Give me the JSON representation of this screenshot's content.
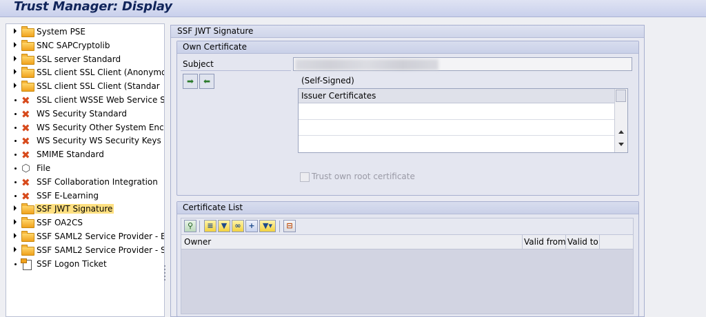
{
  "window": {
    "title": "Trust Manager: Display"
  },
  "tree": {
    "items": [
      {
        "label": "System PSE",
        "icon": "folder-icon",
        "expandable": true
      },
      {
        "label": "SNC SAPCryptolib",
        "icon": "folder-icon",
        "expandable": true
      },
      {
        "label": "SSL server Standard",
        "icon": "folder-icon",
        "expandable": true
      },
      {
        "label": "SSL client SSL Client (Anonymo",
        "icon": "folder-icon",
        "expandable": true
      },
      {
        "label": "SSL client SSL Client (Standar",
        "icon": "folder-icon",
        "expandable": true
      },
      {
        "label": "SSL client WSSE Web Service Se",
        "icon": "error-x-icon",
        "expandable": false
      },
      {
        "label": "WS Security Standard",
        "icon": "error-x-icon",
        "expandable": false
      },
      {
        "label": "WS Security Other System Encr",
        "icon": "error-x-icon",
        "expandable": false
      },
      {
        "label": "WS Security WS Security Keys",
        "icon": "error-x-icon",
        "expandable": false
      },
      {
        "label": "SMIME Standard",
        "icon": "error-x-icon",
        "expandable": false
      },
      {
        "label": "File",
        "icon": "file-icon",
        "expandable": false
      },
      {
        "label": "SSF Collaboration Integration",
        "icon": "error-x-icon",
        "expandable": false
      },
      {
        "label": "SSF E-Learning",
        "icon": "error-x-icon",
        "expandable": false
      },
      {
        "label": "SSF JWT Signature",
        "icon": "folder-icon",
        "expandable": true,
        "selected": true
      },
      {
        "label": "SSF OA2CS",
        "icon": "folder-icon",
        "expandable": true
      },
      {
        "label": "SSF SAML2 Service Provider - E",
        "icon": "folder-icon",
        "expandable": true
      },
      {
        "label": "SSF SAML2 Service Provider - S",
        "icon": "folder-icon",
        "expandable": true
      },
      {
        "label": "SSF Logon Ticket",
        "icon": "ticket-icon",
        "expandable": false
      }
    ]
  },
  "main": {
    "title": "SSF JWT Signature",
    "own_certificate": {
      "title": "Own Certificate",
      "subject_label": "Subject",
      "self_signed": "(Self-Signed)",
      "issuer_header": "Issuer Certificates",
      "trust_label": "Trust own root certificate"
    },
    "certificate_list": {
      "title": "Certificate List",
      "columns": {
        "owner": "Owner",
        "valid_from": "Valid from",
        "valid_to": "Valid to"
      }
    }
  }
}
